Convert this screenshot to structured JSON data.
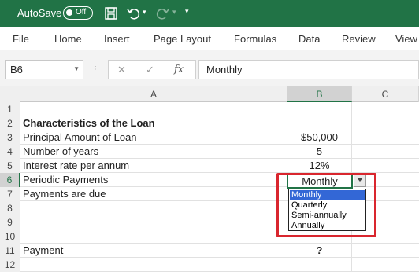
{
  "titlebar": {
    "autosave_label": "AutoSave",
    "toggle_label": "Off",
    "icons": [
      "save-icon",
      "undo-icon",
      "redo-icon",
      "customize-qat-icon"
    ]
  },
  "menu": {
    "items": [
      "File",
      "Home",
      "Insert",
      "Page Layout",
      "Formulas",
      "Data",
      "Review",
      "View"
    ]
  },
  "formula_bar": {
    "name_box": "B6",
    "fx_label": "fx",
    "cancel_glyph": "✕",
    "enter_glyph": "✓",
    "formula_value": "Monthly"
  },
  "grid": {
    "columns": [
      "A",
      "B",
      "C"
    ],
    "rows": [
      {
        "num": "1",
        "a": "",
        "b": ""
      },
      {
        "num": "2",
        "a": "Characteristics of the Loan",
        "b": ""
      },
      {
        "num": "3",
        "a": "Principal Amount of Loan",
        "b": "$50,000"
      },
      {
        "num": "4",
        "a": "Number of years",
        "b": "5"
      },
      {
        "num": "5",
        "a": "Interest rate per annum",
        "b": "12%"
      },
      {
        "num": "6",
        "a": "Periodic Payments",
        "b": "Monthly"
      },
      {
        "num": "7",
        "a": "Payments are due",
        "b": ""
      },
      {
        "num": "8",
        "a": "",
        "b": ""
      },
      {
        "num": "9",
        "a": "",
        "b": ""
      },
      {
        "num": "10",
        "a": "",
        "b": ""
      },
      {
        "num": "11",
        "a": "Payment",
        "b": "?"
      },
      {
        "num": "12",
        "a": "",
        "b": ""
      }
    ]
  },
  "dropdown": {
    "options": [
      "Monthly",
      "Quarterly",
      "Semi-annually",
      "Annually"
    ],
    "selected": "Monthly"
  },
  "colors": {
    "accent": "#217346",
    "highlight": "#d9262e",
    "selection": "#3367d6"
  }
}
